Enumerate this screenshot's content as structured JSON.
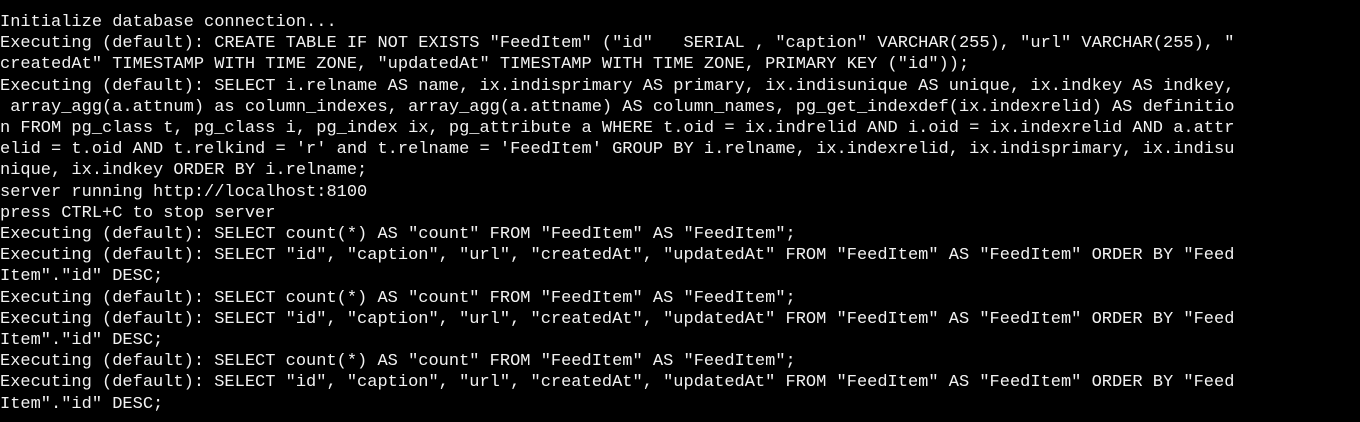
{
  "terminal": {
    "lines": [
      "Initialize database connection...",
      "Executing (default): CREATE TABLE IF NOT EXISTS \"FeedItem\" (\"id\"   SERIAL , \"caption\" VARCHAR(255), \"url\" VARCHAR(255), \"",
      "createdAt\" TIMESTAMP WITH TIME ZONE, \"updatedAt\" TIMESTAMP WITH TIME ZONE, PRIMARY KEY (\"id\"));",
      "Executing (default): SELECT i.relname AS name, ix.indisprimary AS primary, ix.indisunique AS unique, ix.indkey AS indkey,",
      " array_agg(a.attnum) as column_indexes, array_agg(a.attname) AS column_names, pg_get_indexdef(ix.indexrelid) AS definitio",
      "n FROM pg_class t, pg_class i, pg_index ix, pg_attribute a WHERE t.oid = ix.indrelid AND i.oid = ix.indexrelid AND a.attr",
      "elid = t.oid AND t.relkind = 'r' and t.relname = 'FeedItem' GROUP BY i.relname, ix.indexrelid, ix.indisprimary, ix.indisu",
      "nique, ix.indkey ORDER BY i.relname;",
      "server running http://localhost:8100",
      "press CTRL+C to stop server",
      "Executing (default): SELECT count(*) AS \"count\" FROM \"FeedItem\" AS \"FeedItem\";",
      "Executing (default): SELECT \"id\", \"caption\", \"url\", \"createdAt\", \"updatedAt\" FROM \"FeedItem\" AS \"FeedItem\" ORDER BY \"Feed",
      "Item\".\"id\" DESC;",
      "Executing (default): SELECT count(*) AS \"count\" FROM \"FeedItem\" AS \"FeedItem\";",
      "Executing (default): SELECT \"id\", \"caption\", \"url\", \"createdAt\", \"updatedAt\" FROM \"FeedItem\" AS \"FeedItem\" ORDER BY \"Feed",
      "Item\".\"id\" DESC;",
      "Executing (default): SELECT count(*) AS \"count\" FROM \"FeedItem\" AS \"FeedItem\";",
      "Executing (default): SELECT \"id\", \"caption\", \"url\", \"createdAt\", \"updatedAt\" FROM \"FeedItem\" AS \"FeedItem\" ORDER BY \"Feed",
      "Item\".\"id\" DESC;"
    ]
  },
  "colors": {
    "background": "#000000",
    "text": "#f2f2f2"
  }
}
